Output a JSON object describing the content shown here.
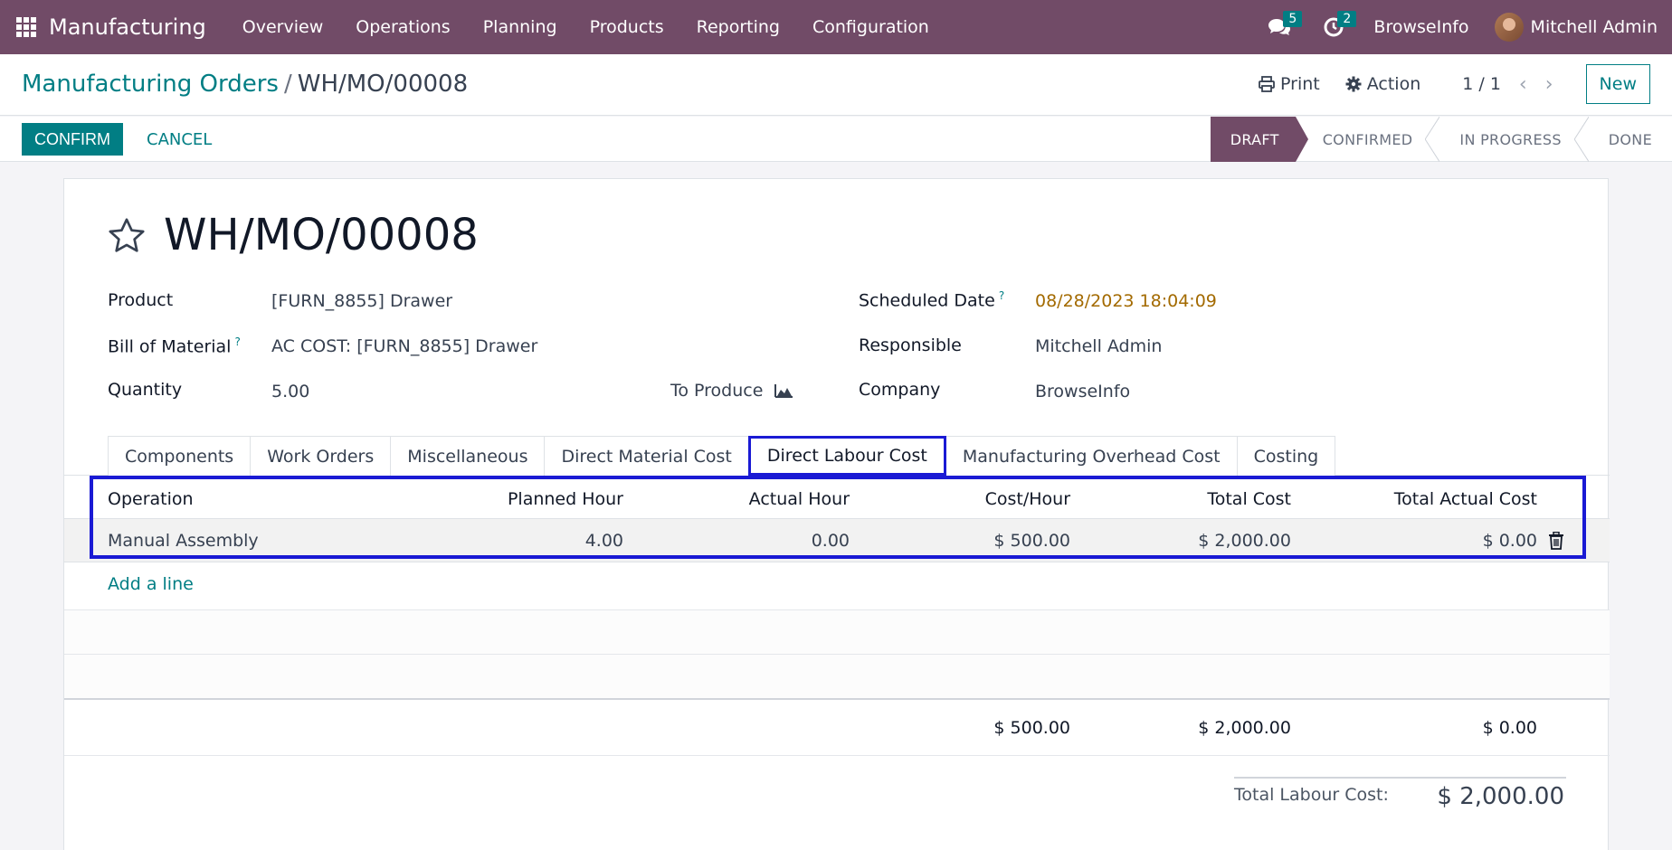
{
  "navbar": {
    "app_name": "Manufacturing",
    "menu": [
      "Overview",
      "Operations",
      "Planning",
      "Products",
      "Reporting",
      "Configuration"
    ],
    "messages_count": "5",
    "activities_count": "2",
    "company": "BrowseInfo",
    "user": "Mitchell Admin"
  },
  "control": {
    "breadcrumb_parent": "Manufacturing Orders",
    "breadcrumb_sep": "/",
    "breadcrumb_current": "WH/MO/00008",
    "print_label": "Print",
    "action_label": "Action",
    "pager": "1 / 1",
    "new_label": "New"
  },
  "statusbar": {
    "confirm_label": "CONFIRM",
    "cancel_label": "CANCEL",
    "stages": [
      "DRAFT",
      "CONFIRMED",
      "IN PROGRESS",
      "DONE"
    ],
    "active_stage": "DRAFT"
  },
  "form": {
    "title": "WH/MO/00008",
    "product_label": "Product",
    "product_value": "[FURN_8855] Drawer",
    "bom_label": "Bill of Material",
    "bom_value": "AC COST: [FURN_8855] Drawer",
    "quantity_label": "Quantity",
    "quantity_value": "5.00",
    "to_produce_label": "To Produce",
    "scheduled_date_label": "Scheduled Date",
    "scheduled_date_value": "08/28/2023 18:04:09",
    "responsible_label": "Responsible",
    "responsible_value": "Mitchell Admin",
    "company_label": "Company",
    "company_value": "BrowseInfo",
    "help_mark": "?"
  },
  "tabs": [
    "Components",
    "Work Orders",
    "Miscellaneous",
    "Direct Material Cost",
    "Direct Labour Cost",
    "Manufacturing Overhead Cost",
    "Costing"
  ],
  "active_tab": "Direct Labour Cost",
  "labour_table": {
    "headers": [
      "Operation",
      "Planned Hour",
      "Actual Hour",
      "Cost/Hour",
      "Total Cost",
      "Total Actual Cost"
    ],
    "rows": [
      [
        "Manual Assembly",
        "4.00",
        "0.00",
        "$ 500.00",
        "$ 2,000.00",
        "$ 0.00"
      ]
    ],
    "add_line_label": "Add a line",
    "footer": {
      "cost_hour": "$ 500.00",
      "total_cost": "$ 2,000.00",
      "total_actual_cost": "$ 0.00"
    }
  },
  "totals": {
    "label": "Total Labour Cost:",
    "value": "$ 2,000.00"
  },
  "colors": {
    "navbar": "#714b67",
    "primary": "#017e84",
    "highlight": "#1a1ad4"
  }
}
